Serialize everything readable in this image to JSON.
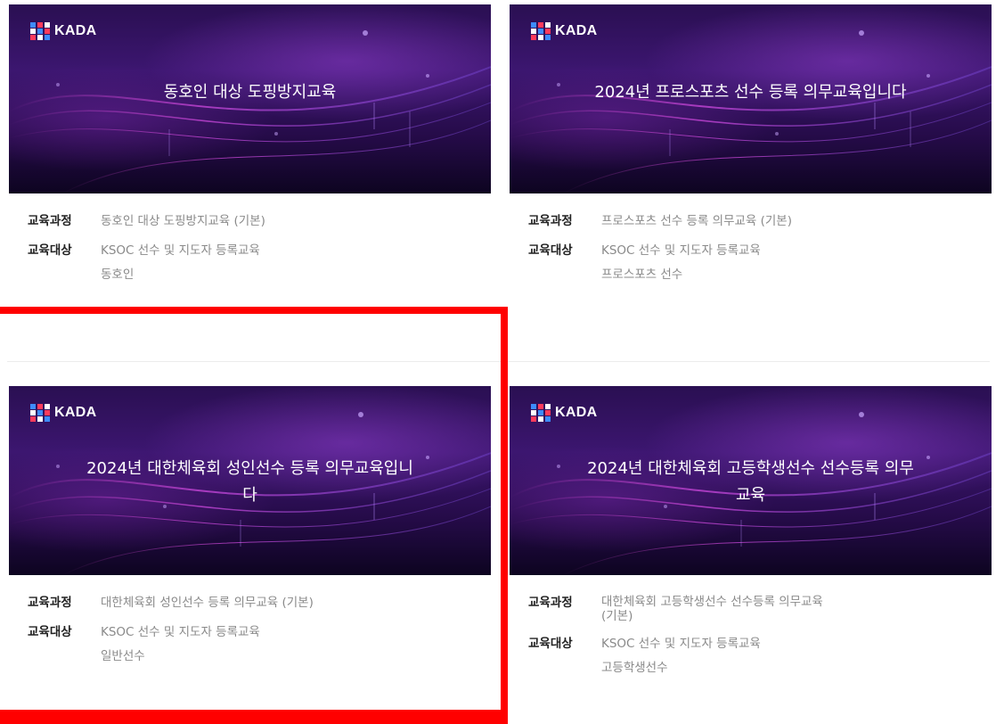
{
  "cards": [
    {
      "logo": "KADA",
      "thumb_title": "동호인 대상 도핑방지교육",
      "course_label": "교육과정",
      "course_value": [
        "동호인 대상 도핑방지교육 (기본)"
      ],
      "target_label": "교육대상",
      "target_value": [
        "KSOC 선수 및 지도자 등록교육",
        "동호인"
      ]
    },
    {
      "logo": "KADA",
      "thumb_title": "2024년 프로스포츠 선수 등록 의무교육입니다",
      "course_label": "교육과정",
      "course_value": [
        "프로스포츠 선수 등록 의무교육 (기본)"
      ],
      "target_label": "교육대상",
      "target_value": [
        "KSOC 선수 및 지도자 등록교육",
        "프로스포츠 선수"
      ]
    },
    {
      "logo": "KADA",
      "thumb_title": [
        "2024년 대한체육회 성인선수 등록 의무교육입니",
        "다"
      ],
      "course_label": "교육과정",
      "course_value": [
        "대한체육회 성인선수 등록 의무교육 (기본)"
      ],
      "target_label": "교육대상",
      "target_value": [
        "KSOC 선수 및 지도자 등록교육",
        "일반선수"
      ]
    },
    {
      "logo": "KADA",
      "thumb_title": [
        "2024년 대한체육회 고등학생선수 선수등록 의무",
        "교육"
      ],
      "course_label": "교육과정",
      "course_value": [
        "대한체육회 고등학생선수 선수등록 의무교육",
        "(기본)"
      ],
      "target_label": "교육대상",
      "target_value": [
        "KSOC 선수 및 지도자 등록교육",
        "고등학생선수"
      ]
    }
  ],
  "colors": {
    "highlight": "#ff0000",
    "thumb_bg": "#2a0f52",
    "label": "#222222",
    "value": "#8a8a8a"
  }
}
